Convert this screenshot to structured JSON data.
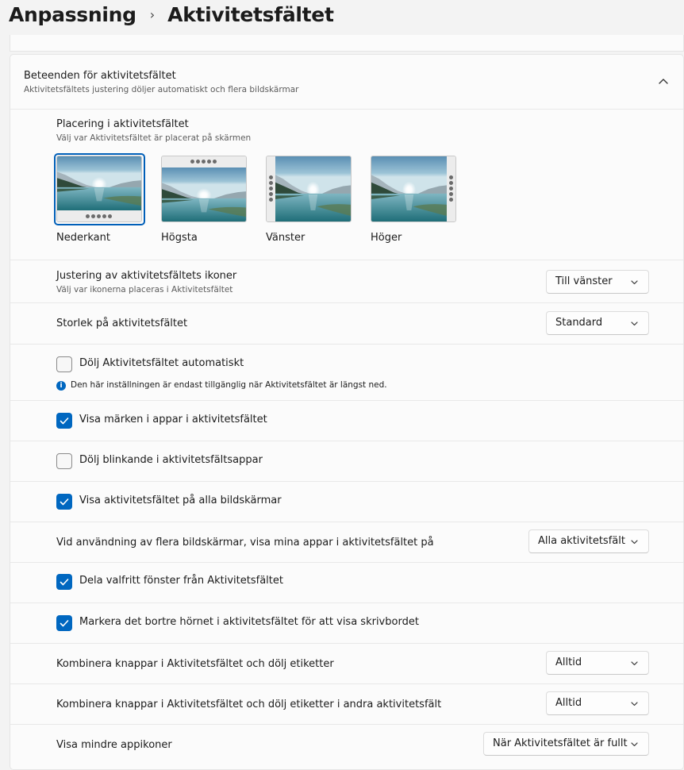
{
  "breadcrumb": {
    "parent": "Anpassning",
    "separator": "›",
    "current": "Aktivitetsfältet"
  },
  "section": {
    "title": "Beteenden för aktivitetsfältet",
    "subtitle": "Aktivitetsfältets justering döljer automatiskt och flera bildskärmar"
  },
  "placement": {
    "title": "Placering i aktivitetsfältet",
    "subtitle": "Välj var Aktivitetsfältet är placerat på skärmen",
    "options": [
      {
        "label": "Nederkant",
        "selected": true
      },
      {
        "label": "Högsta",
        "selected": false
      },
      {
        "label": "Vänster",
        "selected": false
      },
      {
        "label": "Höger",
        "selected": false
      }
    ]
  },
  "alignment": {
    "label": "Justering av aktivitetsfältets ikoner",
    "subtitle": "Välj var ikonerna placeras i Aktivitetsfältet",
    "value": "Till vänster"
  },
  "size": {
    "label": "Storlek på aktivitetsfältet",
    "value": "Standard"
  },
  "autohide": {
    "label": "Dölj Aktivitetsfältet automatiskt",
    "checked": false,
    "info": "Den här inställningen är endast tillgänglig när Aktivitetsfältet är längst ned."
  },
  "badges": {
    "label": "Visa märken i appar i aktivitetsfältet",
    "checked": true
  },
  "flashing": {
    "label": "Dölj blinkande i aktivitetsfältsappar",
    "checked": false
  },
  "all_displays": {
    "label": "Visa aktivitetsfältet på alla bildskärmar",
    "checked": true
  },
  "multi_display": {
    "label": "Vid användning av flera bildskärmar, visa mina appar i aktivitetsfältet på",
    "value": "Alla aktivitetsfält"
  },
  "share_window": {
    "label": "Dela valfritt fönster från Aktivitetsfältet",
    "checked": true
  },
  "far_corner": {
    "label": "Markera det bortre hörnet i aktivitetsfältet för att visa skrivbordet",
    "checked": true
  },
  "combine": {
    "label": "Kombinera knappar i Aktivitetsfältet och dölj etiketter",
    "value": "Alltid"
  },
  "combine_other": {
    "label": "Kombinera knappar i Aktivitetsfältet och dölj etiketter i andra aktivitetsfält",
    "value": "Alltid"
  },
  "small_icons": {
    "label": "Visa mindre appikoner",
    "value": "När Aktivitetsfältet är fullt"
  },
  "colors": {
    "accent": "#0067c0",
    "selection": "#005fb8"
  }
}
